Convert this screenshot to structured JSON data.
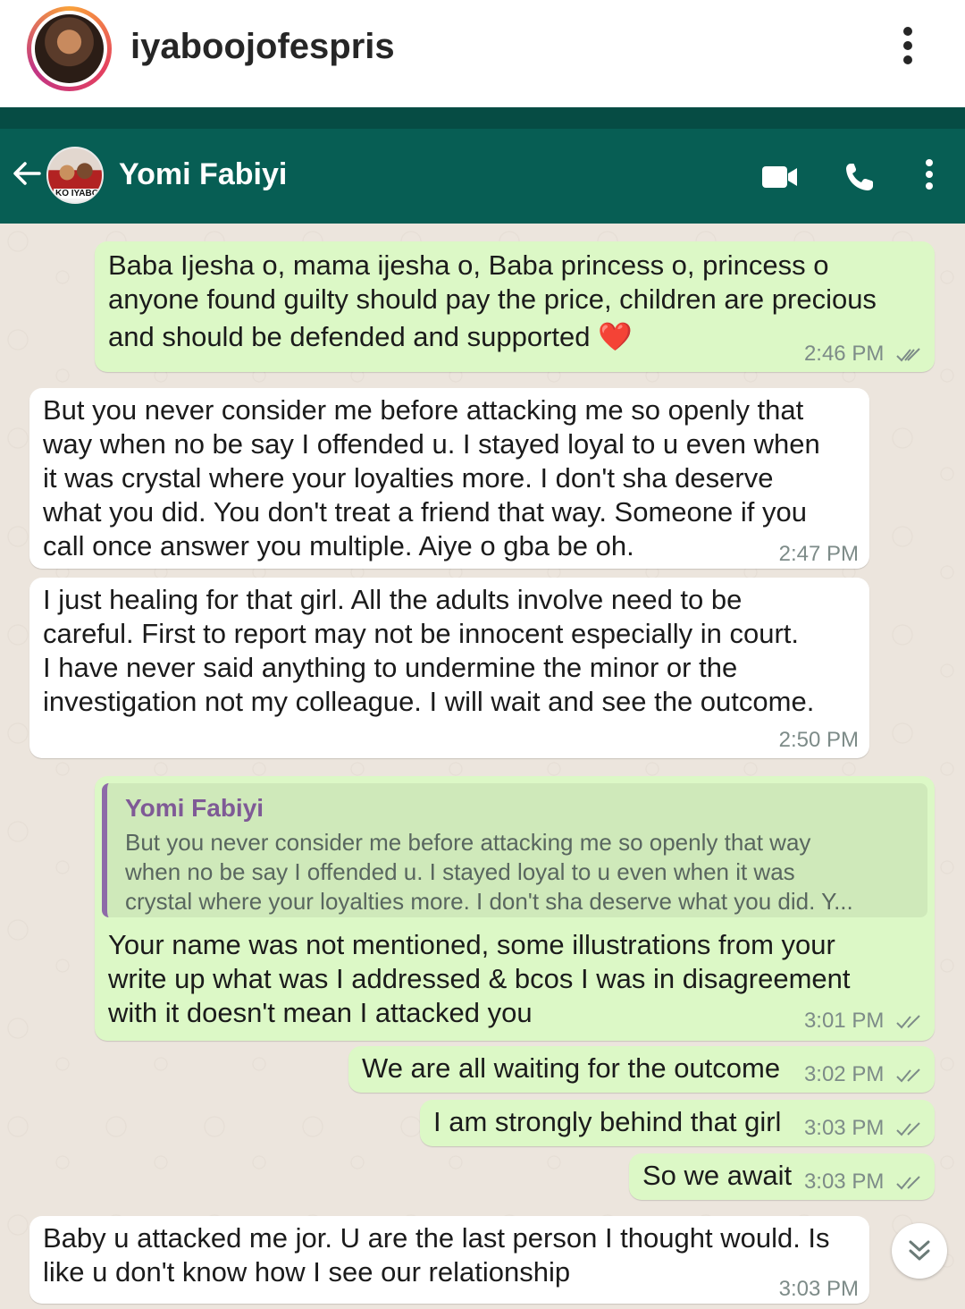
{
  "instagram": {
    "username": "iyaboojofespris",
    "more_icon": "vertical-dots-icon"
  },
  "app_bar": {
    "contact_name": "Yomi Fabiyi",
    "avatar_tag": "KO IYABO",
    "icons": [
      "back-arrow-icon",
      "video-call-icon",
      "phone-icon",
      "more-vertical-icon"
    ],
    "color": "#075e54"
  },
  "messages": [
    {
      "direction": "out",
      "text_lines": [
        "Baba Ijesha o, mama ijesha o, Baba princess o, princess o",
        "anyone found guilty should pay the price, children are precious",
        "and should be defended and supported ❤️"
      ],
      "time": "2:46 PM",
      "ticks": "read"
    },
    {
      "direction": "in",
      "text_lines": [
        "But you never consider me before attacking me so openly that",
        "way when no be say I offended u. I stayed loyal to u even when",
        "it was crystal where your loyalties more. I don't sha deserve",
        "what you did. You don't treat a friend that way. Someone if you",
        "call once answer you multiple. Aiye o gba be oh."
      ],
      "time": "2:47 PM"
    },
    {
      "direction": "in",
      "text_lines": [
        "I just healing for that girl. All the adults involve need to be",
        "careful. First to report may not be innocent especially in court.",
        "I have never said anything to undermine the minor or the",
        "investigation not my colleague. I will wait and see the outcome."
      ],
      "time": "2:50 PM"
    },
    {
      "direction": "out",
      "quote": {
        "name": "Yomi Fabiyi",
        "text_lines": [
          "But you never consider me before attacking me so openly that way",
          "when no be say I offended u. I stayed loyal to u even when it was",
          "crystal where your loyalties more. I don't sha deserve what you did. Y..."
        ]
      },
      "text_lines": [
        "Your name was not mentioned, some illustrations from your",
        "write up what was I addressed & bcos I was in disagreement",
        "with it doesn't mean I attacked you"
      ],
      "time": "3:01 PM",
      "ticks": "read"
    },
    {
      "direction": "out",
      "text": "We are all waiting for the outcome",
      "time": "3:02 PM",
      "ticks": "read"
    },
    {
      "direction": "out",
      "text": "I am strongly behind that girl",
      "time": "3:03 PM",
      "ticks": "read"
    },
    {
      "direction": "out",
      "text": "So we await",
      "time": "3:03 PM",
      "ticks": "read"
    },
    {
      "direction": "in",
      "text_lines": [
        "Baby u attacked me jor. U are the last person I thought would. Is",
        "like u don't know how I see our relationship"
      ],
      "time": "3:03 PM"
    }
  ],
  "scroll_button_icon": "double-chevron-down-icon",
  "colors": {
    "outgoing_bubble": "#dcf8c6",
    "incoming_bubble": "#ffffff",
    "chat_background": "#ece5dd",
    "tick_color": "#7d8b88"
  }
}
